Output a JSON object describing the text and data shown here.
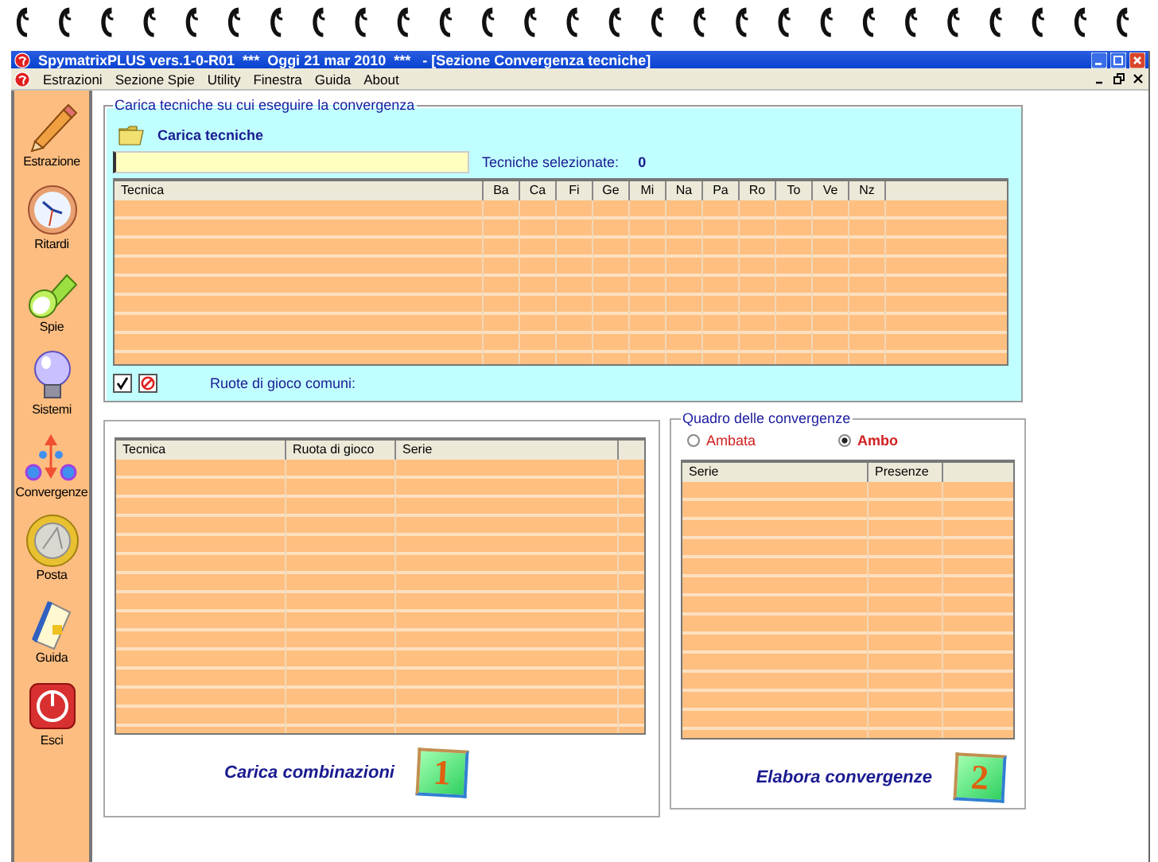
{
  "window": {
    "title": "SpymatrixPLUS vers.1-0-R01  ***  Oggi 21 mar 2010  ***   - [Sezione Convergenza tecniche]"
  },
  "menu": [
    "Estrazioni",
    "Sezione Spie",
    "Utility",
    "Finestra",
    "Guida",
    "About"
  ],
  "sidebar": {
    "items": [
      {
        "label": "Estrazione"
      },
      {
        "label": "Ritardi"
      },
      {
        "label": "Spie"
      },
      {
        "label": "Sistemi"
      },
      {
        "label": "Convergenze"
      },
      {
        "label": "Posta"
      },
      {
        "label": "Guida"
      },
      {
        "label": "Esci"
      }
    ]
  },
  "techniques_panel": {
    "legend": "Carica tecniche su cui eseguire la convergenza",
    "load_label": "Carica tecniche",
    "selected_label": "Tecniche selezionate:",
    "selected_count": "0",
    "table": {
      "columns": [
        "Tecnica",
        "Ba",
        "Ca",
        "Fi",
        "Ge",
        "Mi",
        "Na",
        "Pa",
        "Ro",
        "To",
        "Ve",
        "Nz"
      ]
    },
    "common_wheels_label": "Ruote di gioco comuni:"
  },
  "combinations_panel": {
    "table": {
      "columns": [
        "Tecnica",
        "Ruota di gioco",
        "Serie"
      ]
    },
    "action": {
      "label": "Carica combinazioni",
      "badge": "1"
    }
  },
  "convergence_panel": {
    "legend": "Quadro delle convergenze",
    "options": [
      {
        "label": "Ambata",
        "selected": false
      },
      {
        "label": "Ambo",
        "selected": true
      }
    ],
    "table": {
      "columns": [
        "Serie",
        "Presenze"
      ]
    },
    "action": {
      "label": "Elabora convergenze",
      "badge": "2"
    }
  }
}
